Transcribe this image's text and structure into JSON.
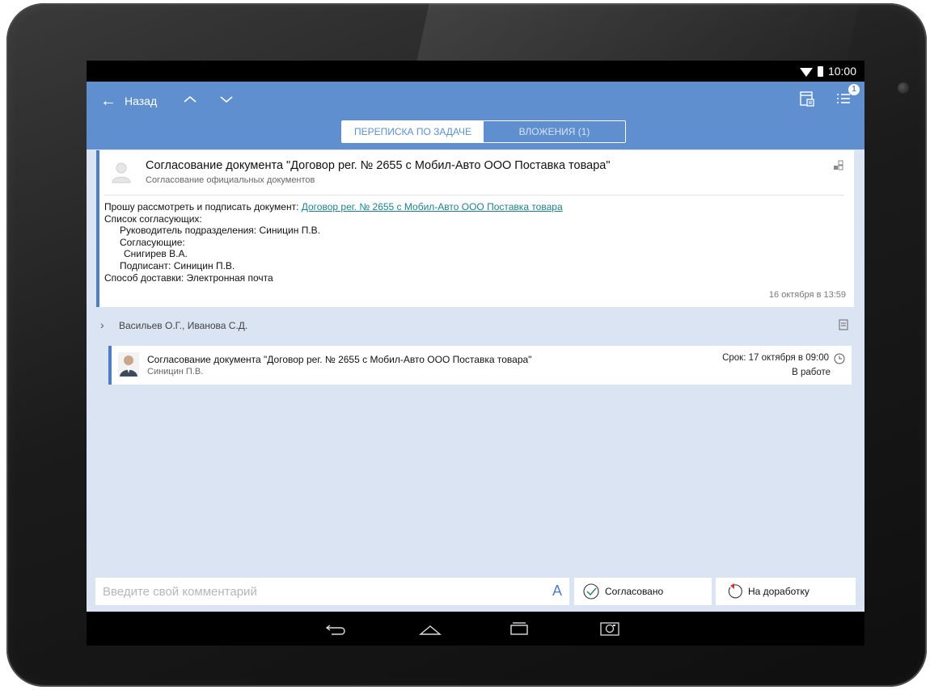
{
  "status_bar": {
    "time": "10:00",
    "wifi_icon": "wifi-icon",
    "battery_icon": "battery-icon"
  },
  "header": {
    "back_label": "Назад",
    "nav_up_icon": "chevron-up-icon",
    "nav_down_icon": "chevron-down-icon",
    "calendar_icon": "calendar-icon",
    "list_icon": "list-icon",
    "badge_count": "1",
    "accent_color": "#5f8fcf"
  },
  "tabs": [
    {
      "label": "ПЕРЕПИСКА ПО ЗАДАЧЕ",
      "active": true
    },
    {
      "label": "ВЛОЖЕНИЯ (1)",
      "active": false
    }
  ],
  "message": {
    "title": "Согласование документа \"Договор рег. № 2655 с Мобил-Авто ООО Поставка товара\"",
    "subtitle": "Согласование официальных документов",
    "body_prefix": "Прошу рассмотреть и подписать документ: ",
    "body_link": "Договор рег. № 2655 с Мобил-Авто ООО Поставка товара",
    "lines": [
      "Список согласующих:",
      "Руководитель подразделения: Синицин П.В.",
      "Согласующие:",
      "Снигирев В.А.",
      "Подписант: Синицин П.В.",
      "Способ доставки: Электронная почта"
    ],
    "timestamp": "16 октября в 13:59"
  },
  "participants": {
    "label": "Васильев О.Г., Иванова С.Д."
  },
  "task": {
    "title": "Согласование документа \"Договор рег. № 2655 с Мобил-Авто ООО Поставка товара\"",
    "assignee": "Синицин П.В.",
    "due": "Срок: 17 октября в 09:00",
    "status": "В работе"
  },
  "comment": {
    "placeholder": "Введите свой комментарий",
    "value": "",
    "font_button": "A"
  },
  "actions": {
    "approve_label": "Согласовано",
    "return_label": "На доработку"
  }
}
